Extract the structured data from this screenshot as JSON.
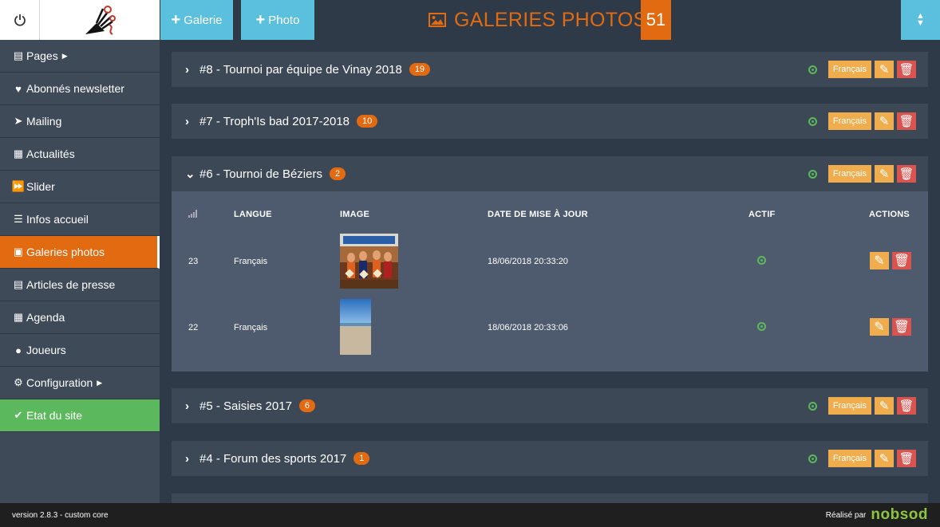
{
  "header": {
    "add_gallery_label": "Galerie",
    "add_photo_label": "Photo",
    "page_title": "GALERIES PHOTOS",
    "gallery_count": "51"
  },
  "sidebar": {
    "items": [
      {
        "label": "Pages",
        "icon": "file-icon",
        "submenu": true
      },
      {
        "label": "Abonnés newsletter",
        "icon": "heart-icon"
      },
      {
        "label": "Mailing",
        "icon": "paper-plane-icon"
      },
      {
        "label": "Actualités",
        "icon": "calendar-icon"
      },
      {
        "label": "Slider",
        "icon": "fast-forward-icon"
      },
      {
        "label": "Infos accueil",
        "icon": "list-icon"
      },
      {
        "label": "Galeries photos",
        "icon": "picture-icon",
        "active": true
      },
      {
        "label": "Articles de presse",
        "icon": "newspaper-icon"
      },
      {
        "label": "Agenda",
        "icon": "calendar-icon"
      },
      {
        "label": "Joueurs",
        "icon": "user-icon"
      },
      {
        "label": "Configuration",
        "icon": "gear-icon",
        "submenu": true
      },
      {
        "label": "Etat du site",
        "icon": "check-circle-icon"
      }
    ]
  },
  "galleries": [
    {
      "title": "#8 - Tournoi par équipe de Vinay 2018",
      "count": "19",
      "lang": "Français",
      "expanded": false
    },
    {
      "title": "#7 - Troph'Is bad 2017-2018",
      "count": "10",
      "lang": "Français",
      "expanded": false
    },
    {
      "title": "#6 - Tournoi de Béziers",
      "count": "2",
      "lang": "Français",
      "expanded": true
    },
    {
      "title": "#5 - Saisies 2017",
      "count": "6",
      "lang": "Français",
      "expanded": false
    },
    {
      "title": "#4 - Forum des sports 2017",
      "count": "1",
      "lang": "Français",
      "expanded": false
    }
  ],
  "photo_table": {
    "headers": {
      "langue": "LANGUE",
      "image": "IMAGE",
      "date": "DATE DE MISE À JOUR",
      "actif": "ACTIF",
      "actions": "ACTIONS"
    },
    "rows": [
      {
        "id": "23",
        "lang": "Français",
        "date": "18/06/2018 20:33:20",
        "active": true
      },
      {
        "id": "22",
        "lang": "Français",
        "date": "18/06/2018 20:33:06",
        "active": true
      }
    ]
  },
  "footer": {
    "version": "version 2.8.3 - custom core",
    "made_by": "Réalisé par",
    "brand": "nobsod"
  },
  "colors": {
    "accent": "#e26a10",
    "info": "#5bc0de",
    "warning": "#f0ad4e",
    "danger": "#d9534f",
    "success": "#5cb85c"
  }
}
